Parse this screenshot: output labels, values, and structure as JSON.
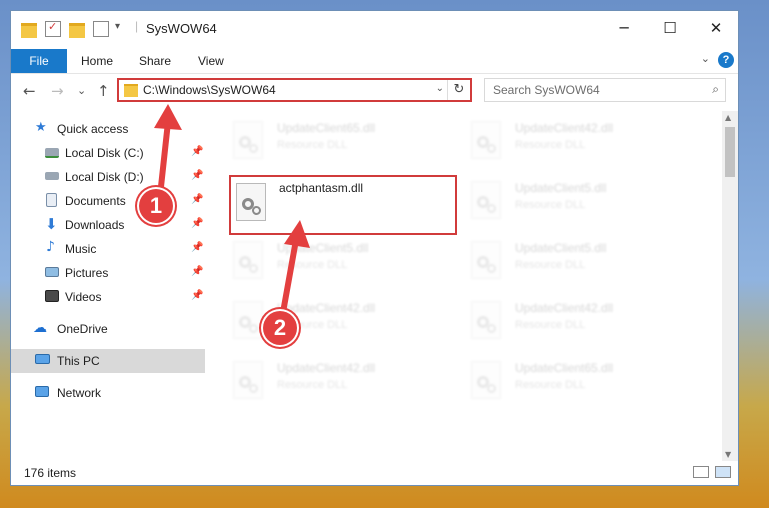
{
  "window": {
    "title": "SysWOW64",
    "controls": {
      "minimize": "─",
      "maximize": "☐",
      "close": "✕"
    }
  },
  "ribbon": {
    "file": "File",
    "tabs": [
      "Home",
      "Share",
      "View"
    ],
    "help": "?",
    "collapse": "⌄"
  },
  "nav": {
    "back": "←",
    "forward": "→",
    "recent": "⌄",
    "up": "↑",
    "address": "C:\\Windows\\SysWOW64",
    "address_dropdown": "⌄",
    "refresh": "↻",
    "search_placeholder": "Search SysWOW64",
    "search_icon": "⌕"
  },
  "sidebar": {
    "items": [
      {
        "label": "Quick access",
        "icon": "star-icon",
        "pinned": false
      },
      {
        "label": "Local Disk (C:)",
        "icon": "drive-icon",
        "pinned": true
      },
      {
        "label": "Local Disk (D:)",
        "icon": "drive-icon",
        "pinned": true
      },
      {
        "label": "Documents",
        "icon": "documents-icon",
        "pinned": true
      },
      {
        "label": "Downloads",
        "icon": "download-icon",
        "pinned": true
      },
      {
        "label": "Music",
        "icon": "music-icon",
        "pinned": true
      },
      {
        "label": "Pictures",
        "icon": "pictures-icon",
        "pinned": true
      },
      {
        "label": "Videos",
        "icon": "videos-icon",
        "pinned": true
      },
      {
        "label": "OneDrive",
        "icon": "cloud-icon",
        "pinned": false
      },
      {
        "label": "This PC",
        "icon": "computer-icon",
        "pinned": false,
        "selected": true
      },
      {
        "label": "Network",
        "icon": "network-icon",
        "pinned": false
      }
    ],
    "pin_glyph": "📌"
  },
  "files": [
    {
      "name": "UpdateClient65.dll",
      "type": "Resource DLL",
      "blurred": true
    },
    {
      "name": "UpdateClient42.dll",
      "type": "Resource DLL",
      "blurred": true
    },
    {
      "name": "actphantasm.dll",
      "type": "",
      "blurred": false,
      "highlighted": true
    },
    {
      "name": "UpdateClient5.dll",
      "type": "Resource DLL",
      "blurred": true
    },
    {
      "name": "UpdateClient5.dll",
      "type": "Resource DLL",
      "blurred": true
    },
    {
      "name": "UpdateClient5.dll",
      "type": "Resource DLL",
      "blurred": true
    },
    {
      "name": "UpdateClient42.dll",
      "type": "Resource DLL",
      "blurred": true
    },
    {
      "name": "UpdateClient42.dll",
      "type": "Resource DLL",
      "blurred": true
    },
    {
      "name": "UpdateClient42.dll",
      "type": "Resource DLL",
      "blurred": true
    },
    {
      "name": "UpdateClient65.dll",
      "type": "Resource DLL",
      "blurred": true
    }
  ],
  "status": {
    "items": "176 items"
  },
  "annotations": {
    "step1": "1",
    "step2": "2",
    "color": "#e33f3f"
  }
}
